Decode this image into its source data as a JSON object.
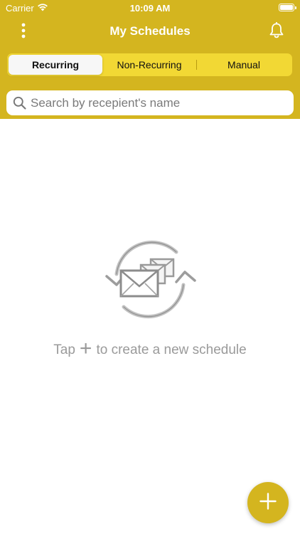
{
  "status_bar": {
    "carrier": "Carrier",
    "time": "10:09 AM",
    "wifi_icon": "wifi-icon",
    "battery_icon": "battery-icon"
  },
  "nav": {
    "title": "My Schedules",
    "menu_icon": "vertical-dots-icon",
    "notification_icon": "bell-icon"
  },
  "tabs": [
    {
      "label": "Recurring",
      "selected": true
    },
    {
      "label": "Non-Recurring",
      "selected": false
    },
    {
      "label": "Manual",
      "selected": false
    }
  ],
  "search": {
    "placeholder": "Search by recepient's name",
    "value": "",
    "icon": "search-icon"
  },
  "empty_state": {
    "illustration_icon": "recurring-envelopes-icon",
    "message_before": "Tap",
    "message_plus": "+",
    "message_after": "to create a new schedule"
  },
  "fab": {
    "icon": "plus-icon"
  },
  "colors": {
    "brand": "#d4b51f",
    "segment_bg": "#f2d834",
    "muted_text": "#9a9a9a"
  }
}
